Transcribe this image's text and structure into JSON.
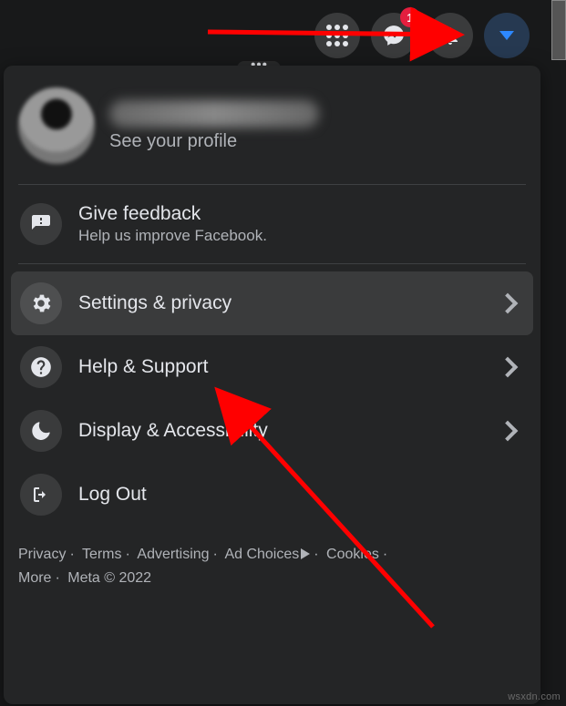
{
  "topbar": {
    "menu_icon": "apps-grid-icon",
    "messenger_icon": "messenger-icon",
    "messenger_badge": "1",
    "notifications_icon": "bell-icon",
    "account_icon": "caret-down-icon"
  },
  "profile": {
    "see_profile_label": "See your profile"
  },
  "feedback": {
    "title": "Give feedback",
    "subtitle": "Help us improve Facebook."
  },
  "menu": {
    "settings_label": "Settings & privacy",
    "help_label": "Help & Support",
    "display_label": "Display & Accessibility",
    "logout_label": "Log Out"
  },
  "footer": {
    "privacy": "Privacy",
    "terms": "Terms",
    "advertising": "Advertising",
    "ad_choices": "Ad Choices",
    "cookies": "Cookies",
    "more": "More",
    "meta": "Meta © 2022"
  },
  "watermark": "wsxdn.com"
}
